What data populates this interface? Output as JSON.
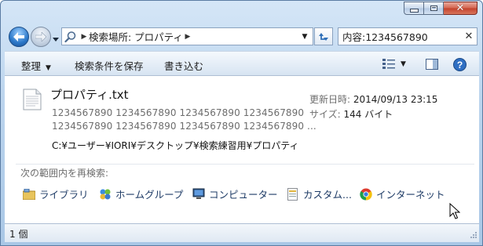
{
  "window": {
    "caption_buttons": {
      "minimize": "minimize",
      "maximize": "maximize",
      "close": "close"
    }
  },
  "nav": {
    "address": {
      "location_label": "検索場所: プロパティ"
    },
    "search": {
      "value": "内容:1234567890"
    }
  },
  "command_bar": {
    "organize": "整理",
    "save_search": "検索条件を保存",
    "burn": "書き込む",
    "view_icon": "view-options-icon",
    "help_icon": "help-icon"
  },
  "result": {
    "file_name": "プロパティ.txt",
    "snippet_line1": "1234567890 1234567890 1234567890 1234567890",
    "snippet_line2": "1234567890 1234567890 1234567890 1234567890 ...",
    "date_label": "更新日時:",
    "date_value": "2014/09/13 23:15",
    "size_label": "サイズ:",
    "size_value": "144 バイト",
    "path": "C:¥ユーザー¥IORI¥デスクトップ¥検索練習用¥プロパティ"
  },
  "search_again": {
    "label": "次の範囲内を再検索:",
    "scopes": [
      {
        "label": "ライブラリ",
        "icon": "libraries-icon"
      },
      {
        "label": "ホームグループ",
        "icon": "homegroup-icon"
      },
      {
        "label": "コンピューター",
        "icon": "computer-icon"
      },
      {
        "label": "カスタム...",
        "icon": "custom-icon"
      },
      {
        "label": "インターネット",
        "icon": "internet-icon"
      }
    ]
  },
  "status_bar": {
    "item_count": "1 個"
  },
  "colors": {
    "accent": "#2b78c9",
    "link": "#1e3b66",
    "muted": "#6d6d6d"
  }
}
